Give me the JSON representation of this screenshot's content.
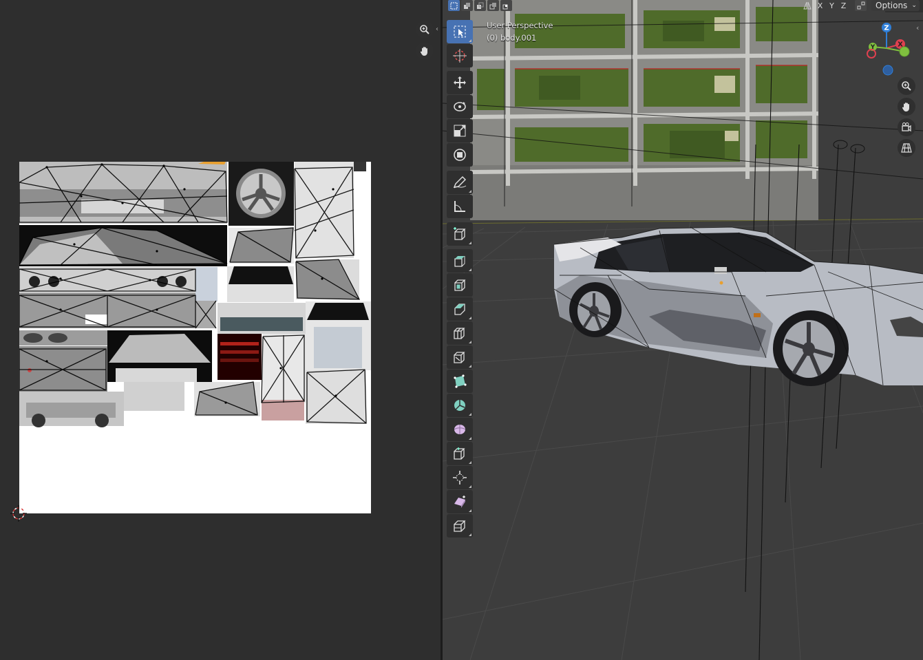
{
  "viewport": {
    "view_label": "User Perspective",
    "object_label": "(0) body.001",
    "options_label": "Options",
    "axis_x": "X",
    "axis_y": "Y",
    "axis_z": "Z"
  },
  "gizmo": {
    "x": "X",
    "y": "Y",
    "z": "Z"
  },
  "toolbar": {
    "tools": [
      "select-box",
      "cursor",
      "move",
      "rotate",
      "scale",
      "transform",
      "annotate",
      "measure",
      "add-cube",
      "extrude",
      "inset",
      "bevel",
      "loop-cut",
      "knife",
      "poly-build",
      "spin",
      "smooth",
      "shrink-fatten",
      "shear",
      "rip"
    ]
  },
  "colors": {
    "accent": "#4772b3",
    "axis_x": "#e0404f",
    "axis_y": "#7fbf3f",
    "axis_z": "#2f7fd9"
  }
}
